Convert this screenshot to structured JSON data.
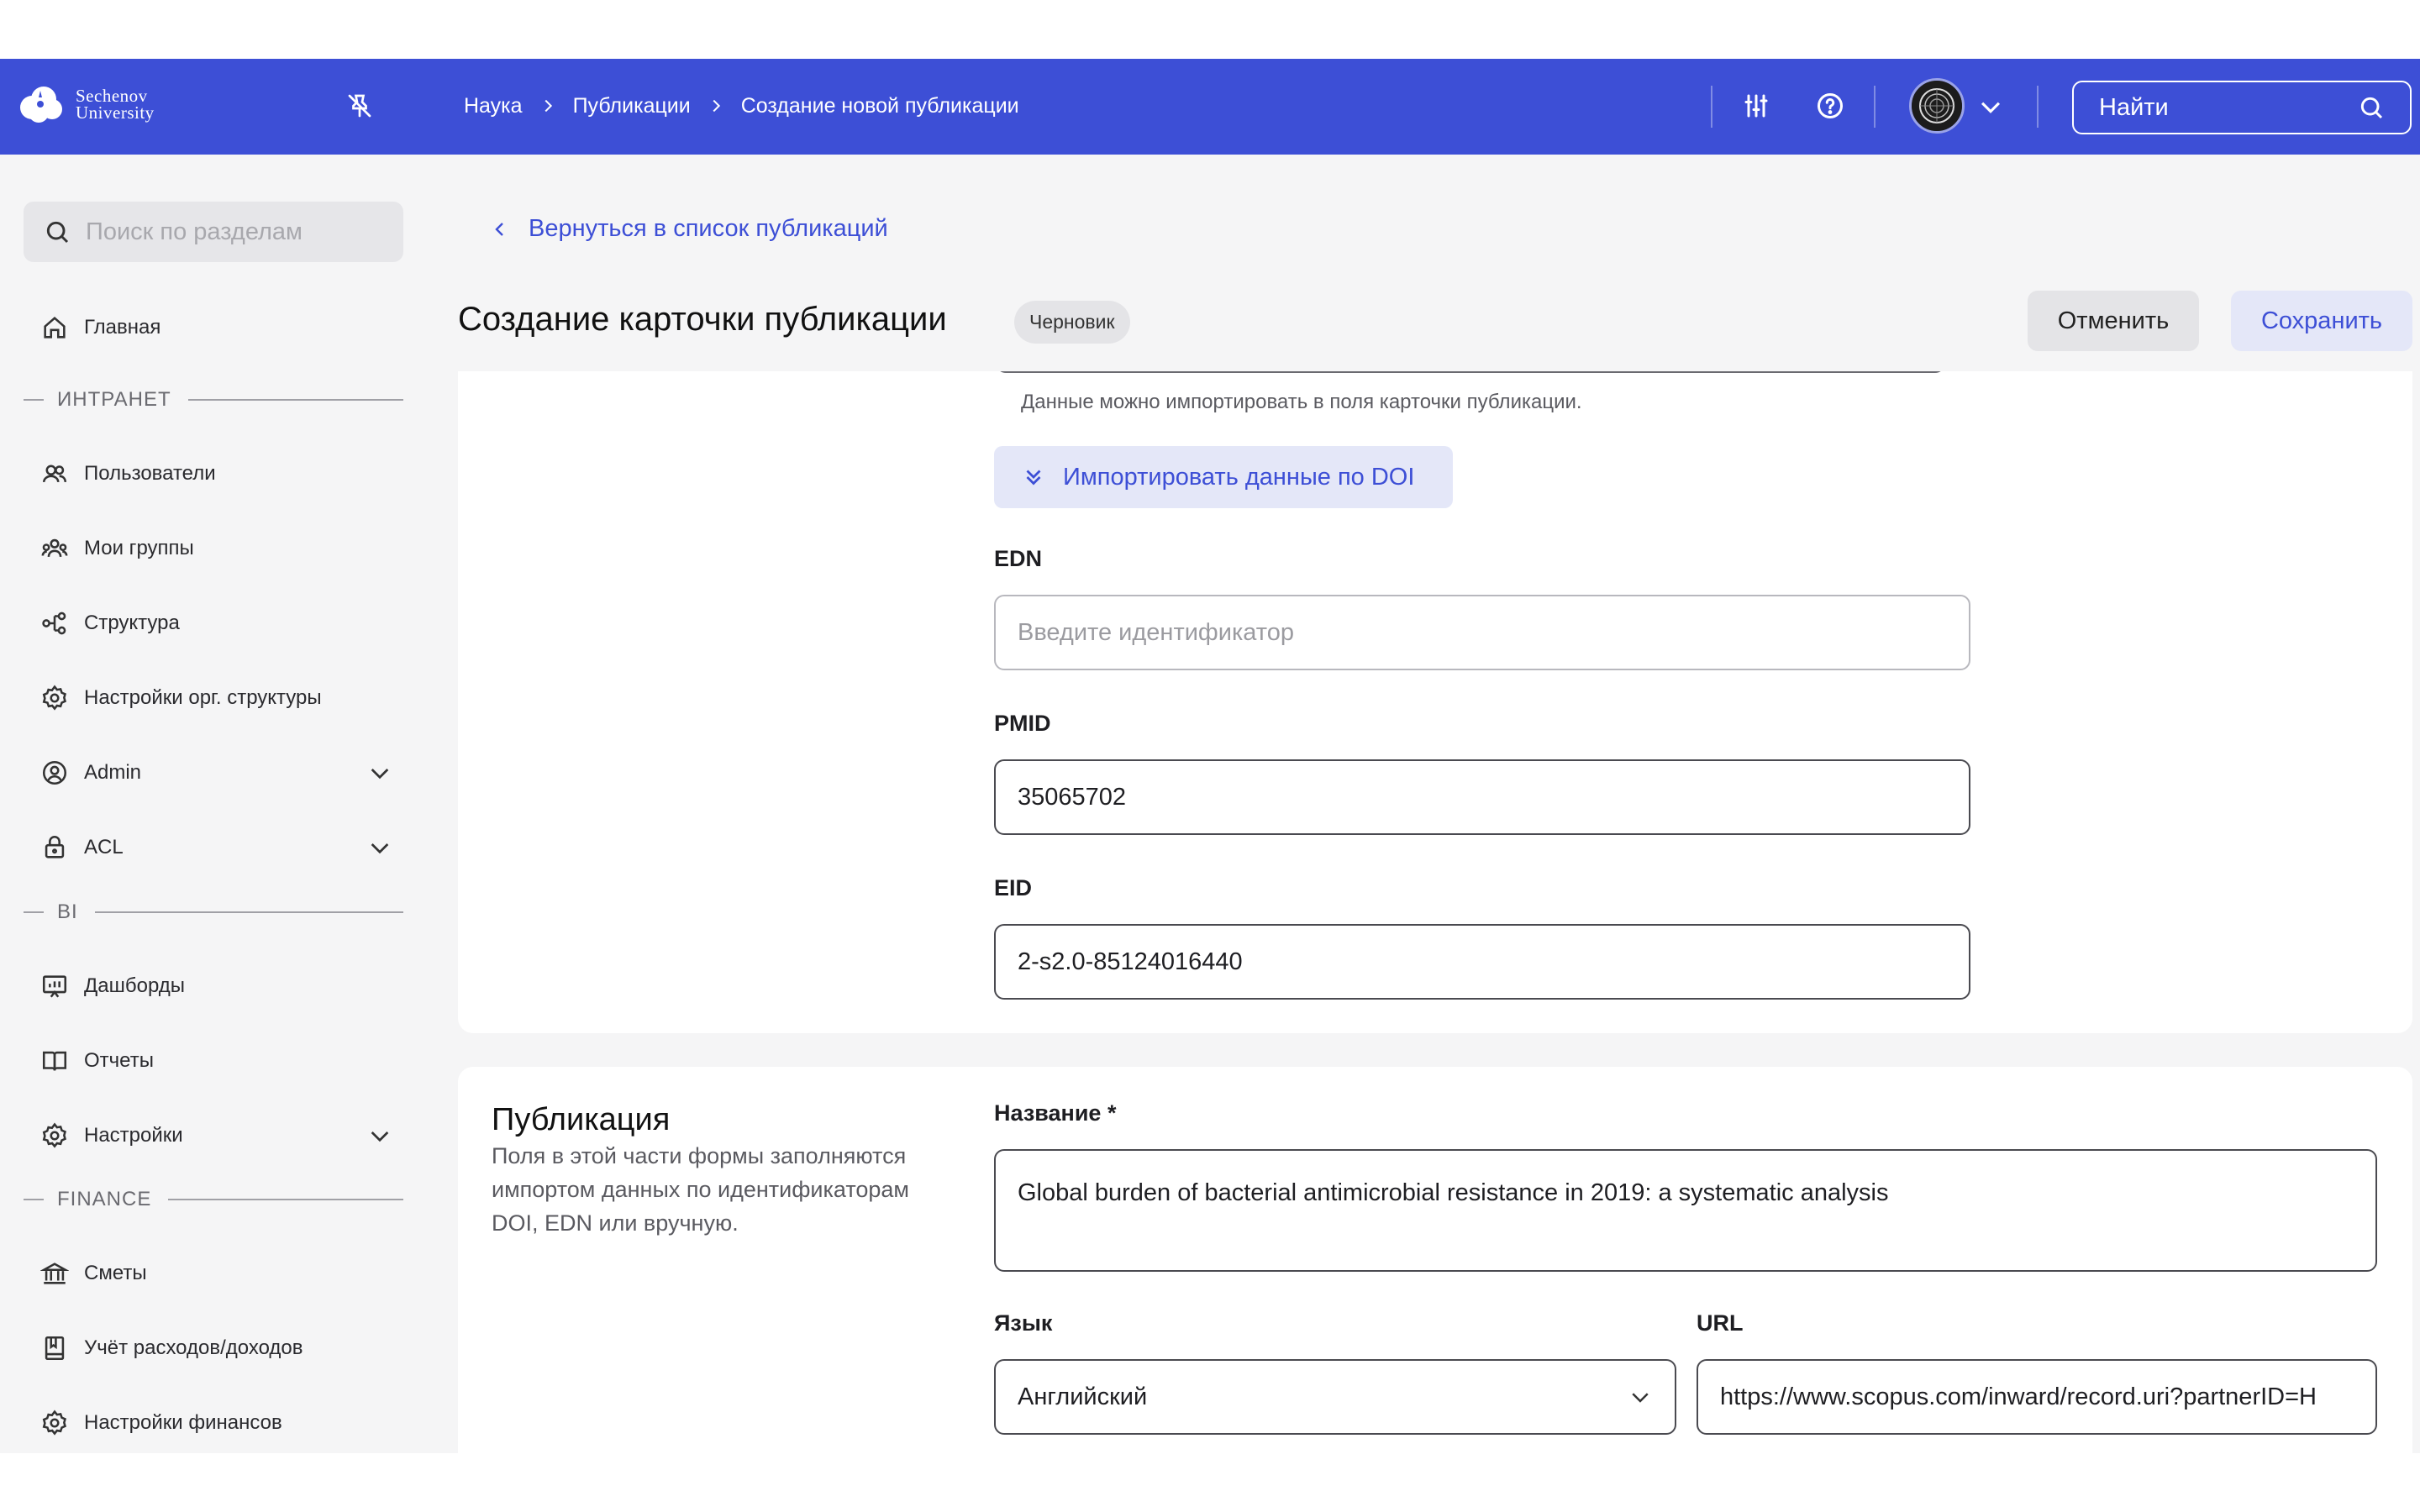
{
  "header": {
    "logo_line1": "Sechenov",
    "logo_line2": "University",
    "breadcrumbs": [
      "Наука",
      "Публикации",
      "Создание новой публикации"
    ],
    "search_label": "Найти"
  },
  "sidebar": {
    "search_placeholder": "Поиск по разделам",
    "home": "Главная",
    "sections": {
      "intranet": "ИНТРАНЕТ",
      "bi": "BI",
      "finance": "FINANCE"
    },
    "items": {
      "users": "Пользователи",
      "groups": "Мои группы",
      "structure": "Структура",
      "org_settings": "Настройки орг. структуры",
      "admin": "Admin",
      "acl": "ACL",
      "dashboards": "Дашборды",
      "reports": "Отчеты",
      "settings": "Настройки",
      "estimates": "Сметы",
      "accounting": "Учёт расходов/доходов",
      "finance_settings": "Настройки финансов"
    }
  },
  "page": {
    "back_link": "Вернуться в список публикаций",
    "title": "Создание карточки публикации",
    "status_badge": "Черновик",
    "cancel_label": "Отменить",
    "save_label": "Сохранить"
  },
  "identifiers": {
    "hint": "Данные можно импортировать в поля карточки публикации.",
    "import_button": "Импортировать данные по DOI",
    "edn_label": "EDN",
    "edn_placeholder": "Введите идентификатор",
    "pmid_label": "PMID",
    "pmid_value": "35065702",
    "eid_label": "EID",
    "eid_value": "2-s2.0-85124016440"
  },
  "publication": {
    "section_title": "Публикация",
    "section_description": "Поля в этой части формы заполняются импортом данных по идентификаторам DOI, EDN или вручную.",
    "name_label": "Название *",
    "name_value": "Global burden of bacterial antimicrobial resistance in 2019: a systematic analysis",
    "language_label": "Язык",
    "language_value": "Английский",
    "url_label": "URL",
    "url_value": "https://www.scopus.com/inward/record.uri?partnerID=H"
  },
  "colors": {
    "brand": "#3d4fd6",
    "sidebar_bg": "#f5f5f6",
    "button_soft": "#e4e7f8"
  }
}
